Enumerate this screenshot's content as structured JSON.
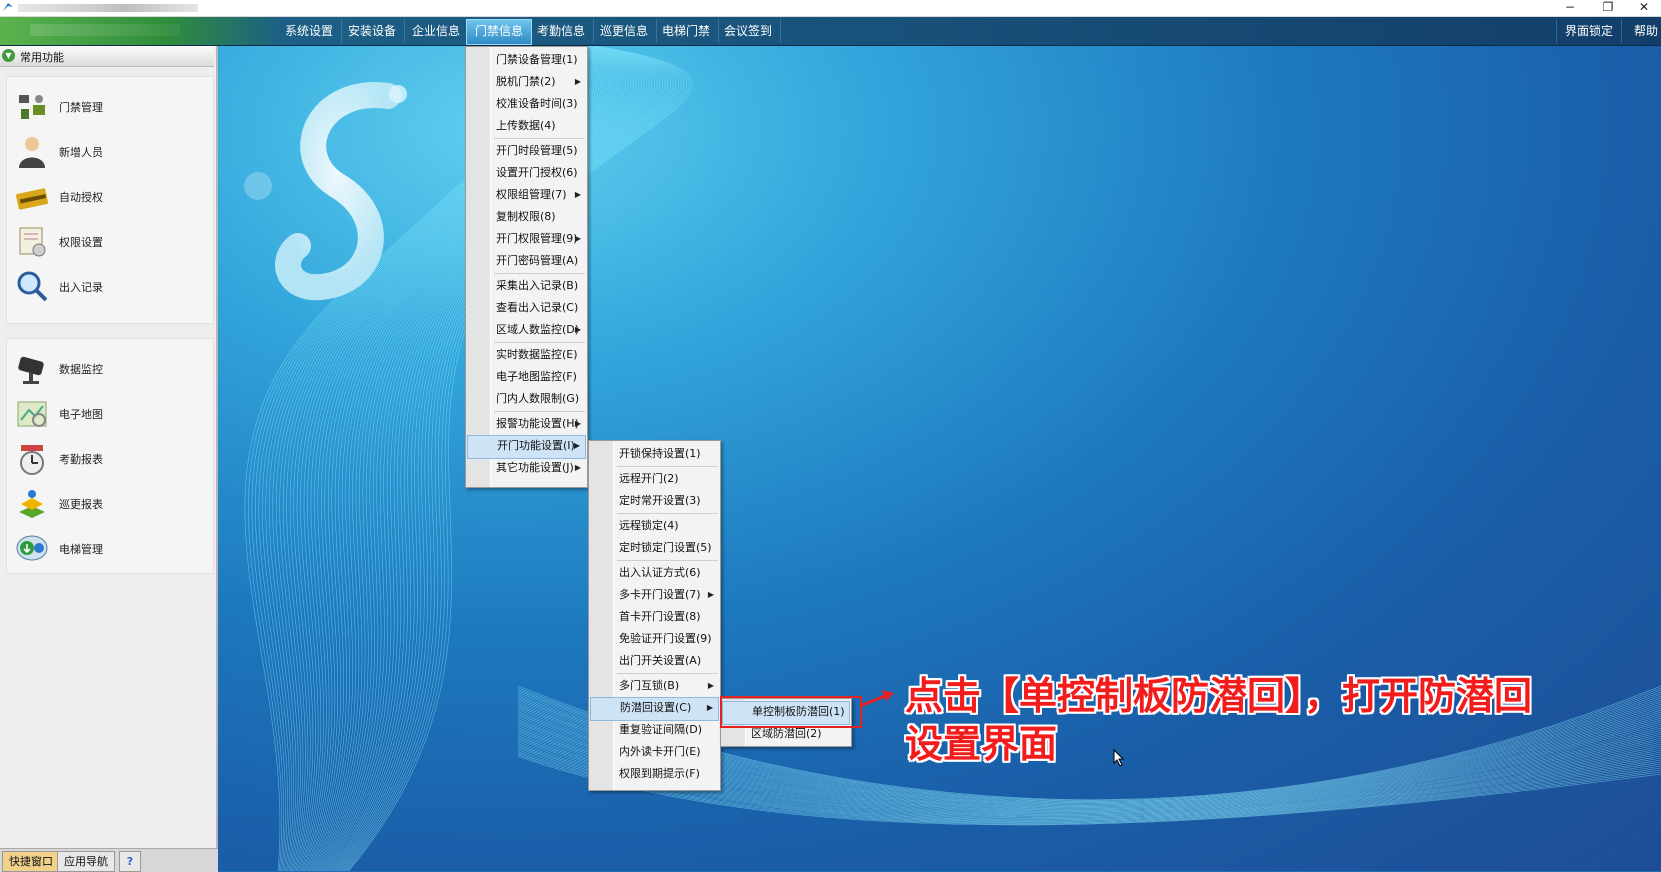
{
  "window": {
    "minimize": "−",
    "restore": "❐",
    "close": "✕"
  },
  "menubar": {
    "items": [
      "系统设置",
      "安装设备",
      "企业信息",
      "门禁信息",
      "考勤信息",
      "巡更信息",
      "电梯门禁",
      "会议签到"
    ],
    "active_index": 3,
    "right_items": [
      "界面锁定",
      "帮助"
    ]
  },
  "sidebar": {
    "header": "常用功能",
    "group1": [
      {
        "label": "门禁管理",
        "icon": "door-access-icon"
      },
      {
        "label": "新增人员",
        "icon": "person-icon"
      },
      {
        "label": "自动授权",
        "icon": "card-icon"
      },
      {
        "label": "权限设置",
        "icon": "permission-doc-icon"
      },
      {
        "label": "出入记录",
        "icon": "magnifier-icon"
      }
    ],
    "group2": [
      {
        "label": "数据监控",
        "icon": "camera-icon"
      },
      {
        "label": "电子地图",
        "icon": "map-icon"
      },
      {
        "label": "考勤报表",
        "icon": "clock-icon"
      },
      {
        "label": "巡更报表",
        "icon": "patrol-icon"
      },
      {
        "label": "电梯管理",
        "icon": "elevator-icon"
      }
    ],
    "bottom_tabs": [
      "快捷窗口",
      "应用导航",
      "?"
    ]
  },
  "menu1": [
    {
      "label": "门禁设备管理(1)"
    },
    {
      "label": "脱机门禁(2)",
      "sub": true
    },
    {
      "label": "校准设备时间(3)"
    },
    {
      "label": "上传数据(4)"
    },
    {
      "sep": true
    },
    {
      "label": "开门时段管理(5)"
    },
    {
      "label": "设置开门授权(6)"
    },
    {
      "label": "权限组管理(7)",
      "sub": true
    },
    {
      "label": "复制权限(8)"
    },
    {
      "label": "开门权限管理(9)",
      "sub": true
    },
    {
      "label": "开门密码管理(A)"
    },
    {
      "sep": true
    },
    {
      "label": "采集出入记录(B)"
    },
    {
      "label": "查看出入记录(C)"
    },
    {
      "label": "区域人数监控(D)",
      "sub": true
    },
    {
      "sep": true
    },
    {
      "label": "实时数据监控(E)"
    },
    {
      "label": "电子地图监控(F)"
    },
    {
      "label": "门内人数限制(G)"
    },
    {
      "sep": true
    },
    {
      "label": "报警功能设置(H)",
      "sub": true
    },
    {
      "label": "开门功能设置(I)",
      "sub": true,
      "hl": true
    },
    {
      "label": "其它功能设置(J)",
      "sub": true
    }
  ],
  "menu2": [
    {
      "label": "开锁保持设置(1)"
    },
    {
      "sep": true
    },
    {
      "label": "远程开门(2)"
    },
    {
      "label": "定时常开设置(3)"
    },
    {
      "sep": true
    },
    {
      "label": "远程锁定(4)"
    },
    {
      "label": "定时锁定门设置(5)"
    },
    {
      "sep": true
    },
    {
      "label": "出入认证方式(6)"
    },
    {
      "label": "多卡开门设置(7)",
      "sub": true
    },
    {
      "label": "首卡开门设置(8)"
    },
    {
      "label": "免验证开门设置(9)"
    },
    {
      "label": "出门开关设置(A)"
    },
    {
      "sep": true
    },
    {
      "label": "多门互锁(B)",
      "sub": true
    },
    {
      "label": "防潜回设置(C)",
      "sub": true,
      "hl": true
    },
    {
      "label": "重复验证间隔(D)"
    },
    {
      "label": "内外读卡开门(E)"
    },
    {
      "label": "权限到期提示(F)"
    }
  ],
  "menu3": [
    {
      "label": "单控制板防潜回(1)",
      "hl": true
    },
    {
      "label": "区域防潜回(2)"
    }
  ],
  "annotation": {
    "line1": "点击【单控制板防潜回】，打开防潜回",
    "line2": "设置界面",
    "color": "#f21c1c"
  }
}
